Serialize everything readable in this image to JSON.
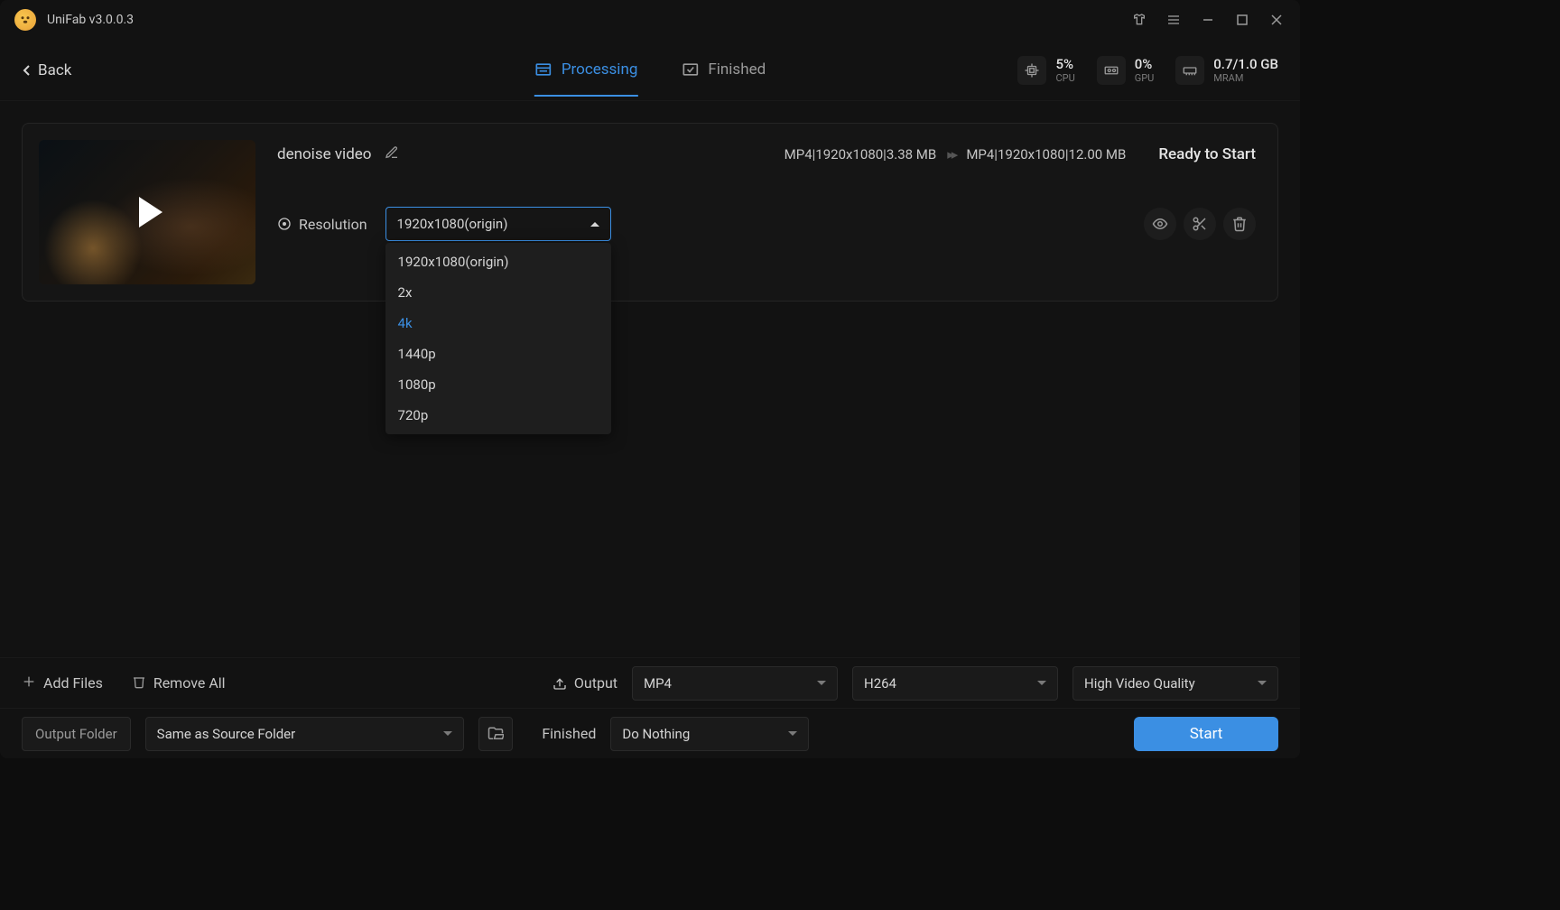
{
  "app": {
    "title": "UniFab v3.0.0.3"
  },
  "header": {
    "back": "Back",
    "tabs": {
      "processing": "Processing",
      "finished": "Finished"
    },
    "usage": {
      "cpu": {
        "value": "5%",
        "label": "CPU"
      },
      "gpu": {
        "value": "0%",
        "label": "GPU"
      },
      "mram": {
        "value": "0.7/1.0 GB",
        "label": "MRAM"
      }
    }
  },
  "job": {
    "filename": "denoise video",
    "source_spec": "MP4|1920x1080|3.38 MB",
    "target_spec": "MP4|1920x1080|12.00 MB",
    "status": "Ready to Start",
    "resolution_label": "Resolution",
    "resolution_selected": "1920x1080(origin)",
    "resolution_options": [
      "1920x1080(origin)",
      "2x",
      "4k",
      "1440p",
      "1080p",
      "720p"
    ],
    "resolution_highlighted_index": 2
  },
  "footer": {
    "add_files": "Add Files",
    "remove_all": "Remove All",
    "output_label": "Output",
    "format": "MP4",
    "codec": "H264",
    "quality": "High Video Quality",
    "folder_label": "Output Folder",
    "folder_path": "Same as Source Folder",
    "finished_label": "Finished",
    "finished_action": "Do Nothing",
    "start": "Start"
  }
}
